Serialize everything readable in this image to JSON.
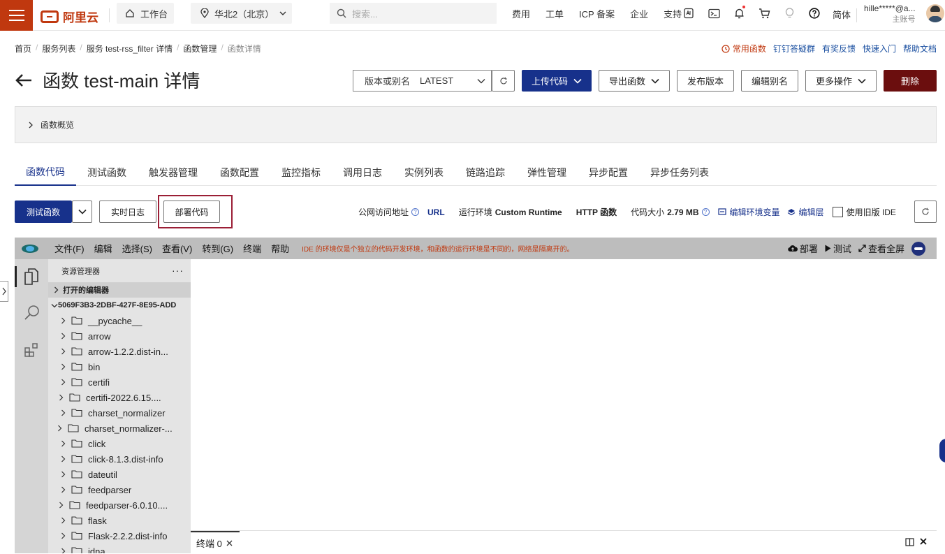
{
  "topbar": {
    "logo": "阿里云",
    "workbench": "工作台",
    "region": "华北2（北京）",
    "search_placeholder": "搜索...",
    "nav": [
      "费用",
      "工单",
      "ICP 备案",
      "企业",
      "支持"
    ],
    "lang": "简体",
    "user_name": "hille*****@a...",
    "user_role": "主账号"
  },
  "breadcrumb": {
    "items": [
      "首页",
      "服务列表",
      "服务 test-rss_filter 详情",
      "函数管理",
      "函数详情"
    ]
  },
  "top_links": {
    "favorites": "常用函数",
    "dingtalk": "钉钉答疑群",
    "feedback": "有奖反馈",
    "quickstart": "快速入门",
    "help": "帮助文档"
  },
  "header": {
    "title": "函数 test-main 详情",
    "version_label": "版本或别名",
    "version_value": "LATEST",
    "upload_code": "上传代码",
    "export_function": "导出函数",
    "publish_version": "发布版本",
    "edit_alias": "编辑别名",
    "more_actions": "更多操作",
    "delete": "删除"
  },
  "overview": {
    "label": "函数概览"
  },
  "tabs": [
    "函数代码",
    "测试函数",
    "触发器管理",
    "函数配置",
    "监控指标",
    "调用日志",
    "实例列表",
    "链路追踪",
    "弹性管理",
    "异步配置",
    "异步任务列表"
  ],
  "actions": {
    "test_function": "测试函数",
    "realtime_log": "实时日志",
    "deploy_code": "部署代码",
    "public_url_label": "公网访问地址",
    "url": "URL",
    "runtime_label": "运行环境",
    "runtime_value": "Custom Runtime",
    "http_function": "HTTP 函数",
    "code_size_label": "代码大小",
    "code_size_value": "2.79 MB",
    "edit_env": "编辑环境变量",
    "edit_layer": "编辑层",
    "legacy_ide": "使用旧版 IDE"
  },
  "ide": {
    "menu": [
      "文件(F)",
      "编辑",
      "选择(S)",
      "查看(V)",
      "转到(G)",
      "终端",
      "帮助"
    ],
    "notice": "IDE 的环境仅是个独立的代码开发环境，和函数的运行环境是不同的，网络是隔离开的。",
    "deploy": "部署",
    "test": "测试",
    "fullscreen": "查看全屏",
    "explorer_title": "资源管理器",
    "open_editors": "打开的编辑器",
    "workspace": "5069F3B3-2DBF-427F-8E95-ADD",
    "files": [
      "__pycache__",
      "arrow",
      "arrow-1.2.2.dist-in...",
      "bin",
      "certifi",
      "certifi-2022.6.15....",
      "charset_normalizer",
      "charset_normalizer-...",
      "click",
      "click-8.1.3.dist-info",
      "dateutil",
      "feedparser",
      "feedparser-6.0.10....",
      "flask",
      "Flask-2.2.2.dist-info",
      "idna"
    ],
    "terminal_tab": "终端 0"
  }
}
